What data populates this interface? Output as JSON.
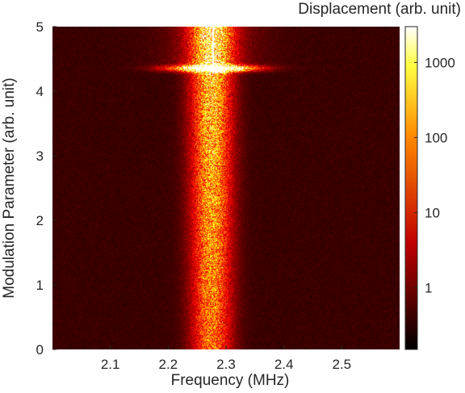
{
  "chart_data": {
    "type": "heatmap",
    "xlabel": "Frequency (MHz)",
    "ylabel": "Modulation Parameter (arb. unit)",
    "colorbar_label": "Displacement (arb. unit)",
    "xlim": [
      2.0,
      2.6
    ],
    "ylim": [
      0,
      5
    ],
    "xticks": [
      2.1,
      2.2,
      2.3,
      2.4,
      2.5
    ],
    "xtick_labels": [
      "2.1",
      "2.2",
      "2.3",
      "2.4",
      "2.5"
    ],
    "yticks": [
      0,
      1,
      2,
      3,
      4,
      5
    ],
    "ytick_labels": [
      "0",
      "1",
      "2",
      "3",
      "4",
      "5"
    ],
    "color_scale": "log",
    "clim": [
      0.15,
      3000
    ],
    "colorbar_ticks": [
      1,
      10,
      100,
      1000
    ],
    "colorbar_tick_labels": [
      "1",
      "10",
      "100",
      "1000"
    ],
    "colormap": "hot",
    "features": {
      "resonance_center_mhz": 2.275,
      "instability_onset_parameter": 4.35,
      "sharp_line_mhz": 2.278
    }
  }
}
